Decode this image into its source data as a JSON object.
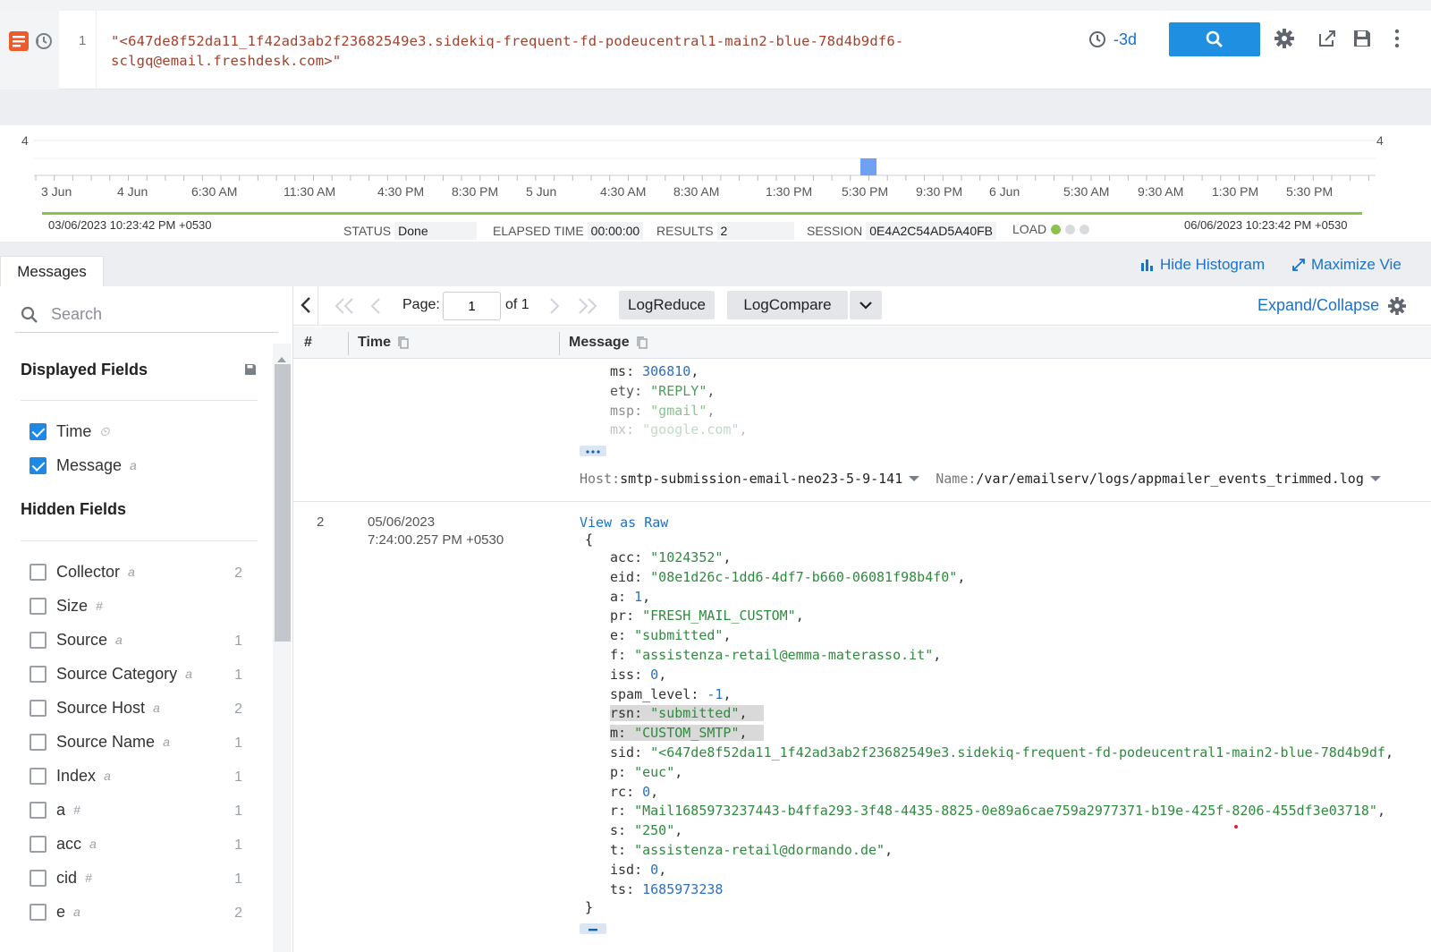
{
  "query": {
    "line_number": "1",
    "text": "\"<647de8f52da11_1f42ad3ab2f23682549e3.sidekiq-frequent-fd-podeucentral1-main2-blue-78d4b9df6-sclgq@email.freshdesk.com>\"",
    "time_range": "-3d"
  },
  "histogram": {
    "y_max_left": "4",
    "y_max_right": "4",
    "x_labels": [
      "3 Jun",
      "4 Jun",
      "6:30 AM",
      "11:30 AM",
      "4:30 PM",
      "8:30 PM",
      "5 Jun",
      "4:30 AM",
      "8:30 AM",
      "1:30 PM",
      "5:30 PM",
      "9:30 PM",
      "6 Jun",
      "5:30 AM",
      "9:30 AM",
      "1:30 PM",
      "5:30 PM"
    ],
    "bar_count": 1,
    "start_time": "03/06/2023 10:23:42 PM +0530",
    "end_time": "06/06/2023 10:23:42 PM +0530",
    "status_label": "STATUS",
    "status_value": "Done",
    "elapsed_label": "ELAPSED TIME",
    "elapsed_value": "00:00:00",
    "results_label": "RESULTS",
    "results_value": "2",
    "session_label": "SESSION",
    "session_value": "0E4A2C54AD5A40FB",
    "load_label": "LOAD"
  },
  "tabs": {
    "messages": "Messages",
    "hide_histogram": "Hide Histogram",
    "maximize": "Maximize Vie"
  },
  "sidebar": {
    "search_placeholder": "Search",
    "displayed_heading": "Displayed Fields",
    "hidden_heading": "Hidden Fields",
    "displayed": [
      {
        "name": "Time",
        "type": "⏲"
      },
      {
        "name": "Message",
        "type": "a"
      }
    ],
    "hidden": [
      {
        "name": "Collector",
        "type": "a",
        "count": "2"
      },
      {
        "name": "Size",
        "type": "#",
        "count": ""
      },
      {
        "name": "Source",
        "type": "a",
        "count": "1"
      },
      {
        "name": "Source Category",
        "type": "a",
        "count": "1"
      },
      {
        "name": "Source Host",
        "type": "a",
        "count": "2"
      },
      {
        "name": "Source Name",
        "type": "a",
        "count": "1"
      },
      {
        "name": "Index",
        "type": "a",
        "count": "1"
      },
      {
        "name": "a",
        "type": "#",
        "count": "1"
      },
      {
        "name": "acc",
        "type": "a",
        "count": "1"
      },
      {
        "name": "cid",
        "type": "#",
        "count": "1"
      },
      {
        "name": "e",
        "type": "a",
        "count": "2"
      }
    ]
  },
  "toolbar": {
    "page_label": "Page:",
    "page_value": "1",
    "page_of": "of 1",
    "logreduce": "LogReduce",
    "logcompare": "LogCompare",
    "expand_collapse": "Expand/Collapse"
  },
  "table": {
    "col_num": "#",
    "col_time": "Time",
    "col_message": "Message"
  },
  "row1": {
    "fields": [
      {
        "k": "ms",
        "v": "306810",
        "t": "n"
      },
      {
        "k": "ety",
        "v": "\"REPLY\"",
        "t": "s"
      },
      {
        "k": "msp",
        "v": "\"gmail\"",
        "t": "s"
      },
      {
        "k": "mx",
        "v": "\"google.com\"",
        "t": "s"
      }
    ],
    "host_label": "Host:",
    "host_value": "smtp-submission-email-neo23-5-9-141",
    "name_label": "Name:",
    "name_value": "/var/emailserv/logs/appmailer_events_trimmed.log"
  },
  "row2": {
    "num": "2",
    "date": "05/06/2023",
    "time": "7:24:00.257 PM +0530",
    "view_raw": "View as Raw",
    "open_brace": "{",
    "close_brace": "}",
    "fields": [
      {
        "k": "acc",
        "v": "\"1024352\"",
        "t": "s"
      },
      {
        "k": "eid",
        "v": "\"08e1d26c-1dd6-4df7-b660-06081f98b4f0\"",
        "t": "s"
      },
      {
        "k": "a",
        "v": "1",
        "t": "n"
      },
      {
        "k": "pr",
        "v": "\"FRESH_MAIL_CUSTOM\"",
        "t": "s"
      },
      {
        "k": "e",
        "v": "\"submitted\"",
        "t": "s"
      },
      {
        "k": "f",
        "v": "\"assistenza-retail@emma-materasso.it\"",
        "t": "s"
      },
      {
        "k": "iss",
        "v": "0",
        "t": "n"
      },
      {
        "k": "spam_level",
        "v": "-1",
        "t": "n"
      },
      {
        "k": "rsn",
        "v": "\"submitted\"",
        "t": "s",
        "hl": true
      },
      {
        "k": "m",
        "v": "\"CUSTOM_SMTP\"",
        "t": "s",
        "hl": true
      },
      {
        "k": "sid",
        "v": "\"<647de8f52da11_1f42ad3ab2f23682549e3.sidekiq-frequent-fd-podeucentral1-main2-blue-78d4b9df",
        "t": "s"
      },
      {
        "k": "p",
        "v": "\"euc\"",
        "t": "s"
      },
      {
        "k": "rc",
        "v": "0",
        "t": "n"
      },
      {
        "k": "r",
        "v": "\"Mail1685973237443-b4ffa293-3f48-4435-8825-0e89a6cae759a2977371-b19e-425f-8206-455df3e03718\"",
        "t": "s"
      },
      {
        "k": "s",
        "v": "\"250\"",
        "t": "s"
      },
      {
        "k": "t",
        "v": "\"assistenza-retail@dormando.de\"",
        "t": "s"
      },
      {
        "k": "isd",
        "v": "0",
        "t": "n"
      },
      {
        "k": "ts",
        "v": "1685973238",
        "t": "n"
      }
    ]
  },
  "colors": {
    "accent": "#1e8fe1",
    "link": "#1a72c9",
    "string": "#2e8b3e",
    "number": "#2a6fc1",
    "progress": "#8bc34a",
    "bar": "#6fa0f2"
  }
}
